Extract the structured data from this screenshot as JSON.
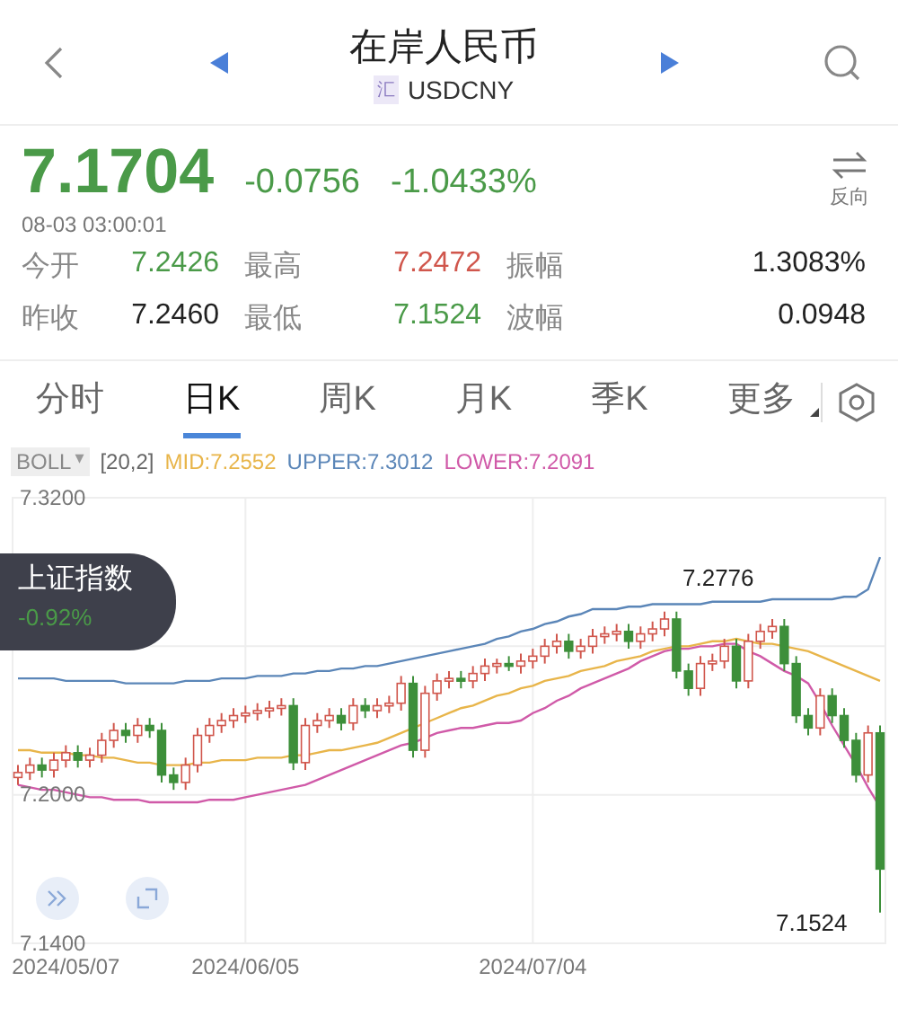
{
  "header": {
    "title": "在岸人民币",
    "badge": "汇",
    "symbol": "USDCNY"
  },
  "quote": {
    "price": "7.1704",
    "change": "-0.0756",
    "change_pct": "-1.0433%",
    "time": "08-03 03:00:01",
    "reverse_label": "反向"
  },
  "stats": [
    {
      "label": "今开",
      "value": "7.2426",
      "color": "#4a9a48"
    },
    {
      "label": "最高",
      "value": "7.2472",
      "color": "#d0564c"
    },
    {
      "label": "振幅",
      "value": "1.3083%",
      "color": "#222222"
    },
    {
      "label": "昨收",
      "value": "7.2460",
      "color": "#222222"
    },
    {
      "label": "最低",
      "value": "7.1524",
      "color": "#4a9a48"
    },
    {
      "label": "波幅",
      "value": "0.0948",
      "color": "#222222"
    }
  ],
  "tabs": [
    {
      "label": "分时",
      "selected": false
    },
    {
      "label": "日K",
      "selected": true
    },
    {
      "label": "周K",
      "selected": false
    },
    {
      "label": "月K",
      "selected": false
    },
    {
      "label": "季K",
      "selected": false
    },
    {
      "label": "更多",
      "selected": false
    }
  ],
  "indicator": {
    "name": "BOLL",
    "caret": "▾",
    "params": "[20,2]",
    "values": [
      {
        "text": "MID:7.2552",
        "color": "#e8b54a"
      },
      {
        "text": "UPPER:7.3012",
        "color": "#5b86b8"
      },
      {
        "text": "LOWER:7.2091",
        "color": "#d05aa8"
      }
    ]
  },
  "chart": {
    "high_label": "7.2776",
    "low_label": "7.1524",
    "chart_data": {
      "type": "candlestick",
      "categories": [
        null,
        null,
        null,
        null,
        "2024/05/07",
        null,
        null,
        null,
        null,
        null,
        null,
        null,
        null,
        null,
        null,
        null,
        null,
        null,
        null,
        "2024/06/05",
        null,
        null,
        null,
        null,
        null,
        null,
        null,
        null,
        null,
        null,
        null,
        null,
        null,
        null,
        null,
        null,
        null,
        null,
        null,
        null,
        null,
        null,
        null,
        "2024/07/04",
        null,
        null,
        null,
        null,
        null,
        null,
        null,
        null,
        null,
        null,
        null,
        null,
        null,
        null,
        null,
        null,
        null,
        null,
        null,
        null,
        null,
        null,
        null,
        null,
        null,
        null,
        null,
        null,
        null
      ],
      "grid": true,
      "ylim": [
        7.14,
        7.32
      ],
      "yticks": [
        {
          "value": 7.32,
          "label": "7.3200"
        },
        {
          "value": 7.2,
          "label": "7.2000"
        },
        {
          "value": 7.14,
          "label": "7.1400"
        }
      ],
      "ohlc": [
        [
          7.207,
          7.212,
          7.204,
          7.209
        ],
        [
          7.209,
          7.215,
          7.206,
          7.212
        ],
        [
          7.212,
          7.215,
          7.207,
          7.21
        ],
        [
          7.21,
          7.217,
          7.207,
          7.214
        ],
        [
          7.214,
          7.22,
          7.211,
          7.217
        ],
        [
          7.217,
          7.22,
          7.211,
          7.214
        ],
        [
          7.214,
          7.219,
          7.211,
          7.216
        ],
        [
          7.216,
          7.225,
          7.213,
          7.222
        ],
        [
          7.222,
          7.229,
          7.219,
          7.226
        ],
        [
          7.226,
          7.229,
          7.221,
          7.224
        ],
        [
          7.224,
          7.231,
          7.221,
          7.228
        ],
        [
          7.228,
          7.231,
          7.223,
          7.226
        ],
        [
          7.226,
          7.229,
          7.205,
          7.208
        ],
        [
          7.208,
          7.211,
          7.202,
          7.205
        ],
        [
          7.205,
          7.215,
          7.202,
          7.212
        ],
        [
          7.212,
          7.227,
          7.209,
          7.224
        ],
        [
          7.224,
          7.231,
          7.221,
          7.228
        ],
        [
          7.228,
          7.233,
          7.225,
          7.23
        ],
        [
          7.23,
          7.235,
          7.227,
          7.232
        ],
        [
          7.232,
          7.236,
          7.229,
          7.233
        ],
        [
          7.233,
          7.237,
          7.23,
          7.234
        ],
        [
          7.234,
          7.238,
          7.231,
          7.235
        ],
        [
          7.235,
          7.239,
          7.232,
          7.236
        ],
        [
          7.236,
          7.239,
          7.21,
          7.213
        ],
        [
          7.213,
          7.231,
          7.21,
          7.228
        ],
        [
          7.228,
          7.233,
          7.225,
          7.23
        ],
        [
          7.23,
          7.235,
          7.227,
          7.232
        ],
        [
          7.232,
          7.235,
          7.226,
          7.229
        ],
        [
          7.229,
          7.239,
          7.226,
          7.236
        ],
        [
          7.236,
          7.239,
          7.231,
          7.234
        ],
        [
          7.234,
          7.239,
          7.231,
          7.236
        ],
        [
          7.236,
          7.24,
          7.233,
          7.237
        ],
        [
          7.237,
          7.248,
          7.234,
          7.245
        ],
        [
          7.245,
          7.248,
          7.215,
          7.218
        ],
        [
          7.218,
          7.244,
          7.215,
          7.241
        ],
        [
          7.241,
          7.249,
          7.238,
          7.246
        ],
        [
          7.246,
          7.25,
          7.243,
          7.247
        ],
        [
          7.247,
          7.25,
          7.243,
          7.246
        ],
        [
          7.246,
          7.252,
          7.243,
          7.249
        ],
        [
          7.249,
          7.255,
          7.246,
          7.252
        ],
        [
          7.252,
          7.255,
          7.249,
          7.253
        ],
        [
          7.253,
          7.256,
          7.25,
          7.252
        ],
        [
          7.252,
          7.257,
          7.249,
          7.254
        ],
        [
          7.254,
          7.259,
          7.251,
          7.256
        ],
        [
          7.256,
          7.263,
          7.253,
          7.26
        ],
        [
          7.26,
          7.265,
          7.257,
          7.262
        ],
        [
          7.262,
          7.265,
          7.255,
          7.258
        ],
        [
          7.258,
          7.263,
          7.255,
          7.26
        ],
        [
          7.26,
          7.267,
          7.257,
          7.264
        ],
        [
          7.264,
          7.268,
          7.261,
          7.265
        ],
        [
          7.265,
          7.269,
          7.262,
          7.266
        ],
        [
          7.266,
          7.269,
          7.259,
          7.262
        ],
        [
          7.262,
          7.268,
          7.259,
          7.265
        ],
        [
          7.265,
          7.27,
          7.262,
          7.267
        ],
        [
          7.267,
          7.274,
          7.264,
          7.271
        ],
        [
          7.271,
          7.274,
          7.247,
          7.25
        ],
        [
          7.25,
          7.253,
          7.24,
          7.243
        ],
        [
          7.243,
          7.256,
          7.24,
          7.253
        ],
        [
          7.253,
          7.257,
          7.25,
          7.254
        ],
        [
          7.254,
          7.263,
          7.251,
          7.26
        ],
        [
          7.26,
          7.263,
          7.243,
          7.246
        ],
        [
          7.246,
          7.265,
          7.243,
          7.262
        ],
        [
          7.262,
          7.269,
          7.259,
          7.266
        ],
        [
          7.266,
          7.271,
          7.263,
          7.268
        ],
        [
          7.268,
          7.271,
          7.25,
          7.253
        ],
        [
          7.253,
          7.256,
          7.229,
          7.232
        ],
        [
          7.232,
          7.235,
          7.224,
          7.227
        ],
        [
          7.227,
          7.243,
          7.224,
          7.24
        ],
        [
          7.24,
          7.243,
          7.229,
          7.232
        ],
        [
          7.232,
          7.235,
          7.219,
          7.222
        ],
        [
          7.222,
          7.225,
          7.205,
          7.208
        ],
        [
          7.208,
          7.228,
          7.205,
          7.225
        ],
        [
          7.225,
          7.228,
          7.1524,
          7.17
        ]
      ],
      "series": [
        {
          "type": "line",
          "color": "#5b86b8",
          "values": [
            7.247,
            7.247,
            7.247,
            7.247,
            7.246,
            7.246,
            7.246,
            7.246,
            7.246,
            7.245,
            7.245,
            7.245,
            7.245,
            7.245,
            7.246,
            7.246,
            7.246,
            7.247,
            7.247,
            7.247,
            7.248,
            7.248,
            7.248,
            7.249,
            7.249,
            7.25,
            7.25,
            7.251,
            7.251,
            7.252,
            7.252,
            7.253,
            7.254,
            7.255,
            7.256,
            7.257,
            7.258,
            7.259,
            7.26,
            7.261,
            7.263,
            7.264,
            7.266,
            7.267,
            7.269,
            7.27,
            7.272,
            7.273,
            7.275,
            7.275,
            7.275,
            7.276,
            7.276,
            7.277,
            7.277,
            7.277,
            7.277,
            7.277,
            7.278,
            7.278,
            7.278,
            7.278,
            7.278,
            7.279,
            7.279,
            7.279,
            7.279,
            7.279,
            7.279,
            7.28,
            7.28,
            7.283,
            7.296
          ]
        },
        {
          "type": "line",
          "color": "#e8b54a",
          "values": [
            7.218,
            7.218,
            7.217,
            7.217,
            7.217,
            7.216,
            7.216,
            7.215,
            7.215,
            7.214,
            7.213,
            7.213,
            7.212,
            7.212,
            7.212,
            7.213,
            7.213,
            7.214,
            7.214,
            7.214,
            7.215,
            7.215,
            7.215,
            7.216,
            7.216,
            7.217,
            7.218,
            7.218,
            7.219,
            7.22,
            7.221,
            7.223,
            7.225,
            7.227,
            7.229,
            7.231,
            7.233,
            7.235,
            7.236,
            7.238,
            7.24,
            7.241,
            7.243,
            7.244,
            7.246,
            7.247,
            7.248,
            7.25,
            7.251,
            7.252,
            7.254,
            7.255,
            7.256,
            7.258,
            7.259,
            7.26,
            7.26,
            7.261,
            7.262,
            7.262,
            7.263,
            7.262,
            7.261,
            7.261,
            7.26,
            7.259,
            7.258,
            7.256,
            7.254,
            7.252,
            7.25,
            7.248,
            7.246
          ]
        },
        {
          "type": "line",
          "color": "#d05aa8",
          "values": [
            7.204,
            7.203,
            7.202,
            7.202,
            7.201,
            7.2,
            7.199,
            7.199,
            7.198,
            7.198,
            7.198,
            7.197,
            7.197,
            7.197,
            7.197,
            7.197,
            7.198,
            7.198,
            7.198,
            7.199,
            7.2,
            7.201,
            7.202,
            7.203,
            7.204,
            7.206,
            7.208,
            7.21,
            7.212,
            7.214,
            7.216,
            7.218,
            7.22,
            7.221,
            7.223,
            7.225,
            7.226,
            7.227,
            7.227,
            7.228,
            7.229,
            7.229,
            7.23,
            7.233,
            7.235,
            7.238,
            7.24,
            7.243,
            7.245,
            7.247,
            7.249,
            7.251,
            7.254,
            7.256,
            7.258,
            7.259,
            7.259,
            7.26,
            7.26,
            7.261,
            7.261,
            7.258,
            7.256,
            7.253,
            7.25,
            7.248,
            7.245,
            7.237,
            7.228,
            7.22,
            7.212,
            7.203,
            7.195
          ]
        }
      ]
    }
  },
  "overlay": {
    "title": "上证指数",
    "change": "-0.92%"
  }
}
